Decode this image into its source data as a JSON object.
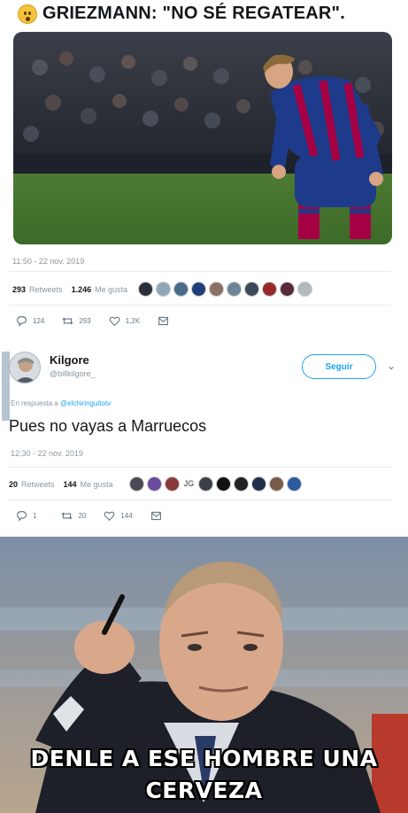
{
  "tweet1": {
    "text": "GRIEZMANN: \"NO SÉ REGATEAR\".",
    "emoji": "flushed-face-emoji",
    "timestamp": "11:50 - 22 nov. 2019",
    "retweets_count": "293",
    "retweets_label": "Retweets",
    "likes_count": "1.246",
    "likes_label": "Me gusta",
    "actions": {
      "replies": "124",
      "retweets": "293",
      "likes": "1,2K"
    }
  },
  "tweet2": {
    "author_name": "Kilgore",
    "author_handle": "@billkilgore_",
    "follow_label": "Seguir",
    "reply_prefix": "En respuesta a",
    "reply_handle": "@elchiringuitotv",
    "text": "Pues no vayas a Marruecos",
    "timestamp": "12:30 - 22 nov. 2019",
    "retweets_count": "20",
    "retweets_label": "Retweets",
    "likes_count": "144",
    "likes_label": "Me gusta",
    "avatar_initials": "JG",
    "actions": {
      "replies": "1",
      "retweets": "20",
      "likes": "144"
    }
  },
  "meme": {
    "caption_line1": "DENLE A ESE HOMBRE UNA",
    "caption_line2": "CERVEZA"
  },
  "colors": {
    "twitter_blue": "#1da1f2",
    "muted_text": "#8a97a3",
    "barca_blue": "#1e3a8a",
    "barca_red": "#a50044"
  }
}
